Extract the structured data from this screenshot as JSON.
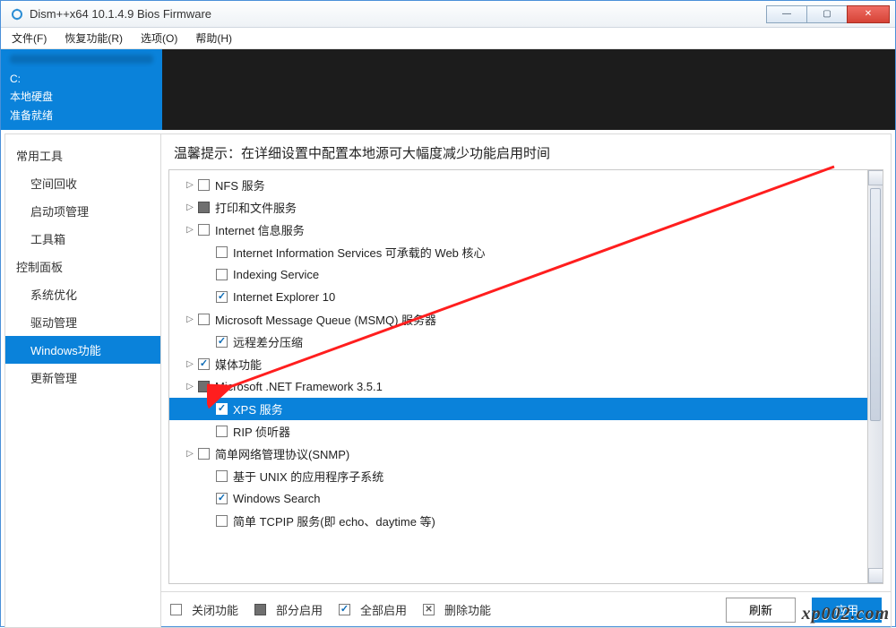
{
  "window": {
    "title": "Dism++x64 10.1.4.9 Bios Firmware"
  },
  "menu": {
    "file": "文件(F)",
    "recover": "恢复功能(R)",
    "options": "选项(O)",
    "help": "帮助(H)"
  },
  "header": {
    "drive": "C:",
    "disk": "本地硬盘",
    "status": "准备就绪"
  },
  "sidebar": {
    "group1_title": "常用工具",
    "group1": [
      "空间回收",
      "启动项管理",
      "工具箱"
    ],
    "group2_title": "控制面板",
    "group2": [
      "系统优化",
      "驱动管理",
      "Windows功能",
      "更新管理"
    ],
    "active_index": 2
  },
  "main": {
    "hint": "温馨提示：在详细设置中配置本地源可大幅度减少功能启用时间",
    "tree": [
      {
        "label": "NFS 服务",
        "expander": true,
        "checked": "none"
      },
      {
        "label": "打印和文件服务",
        "expander": true,
        "checked": "partial"
      },
      {
        "label": "Internet 信息服务",
        "expander": true,
        "checked": "none"
      },
      {
        "label": "Internet Information Services 可承载的 Web 核心",
        "expander": false,
        "checked": "none",
        "indent": true
      },
      {
        "label": "Indexing Service",
        "expander": false,
        "checked": "none",
        "indent": true
      },
      {
        "label": "Internet Explorer 10",
        "expander": false,
        "checked": "checked",
        "indent": true
      },
      {
        "label": "Microsoft Message Queue (MSMQ) 服务器",
        "expander": true,
        "checked": "none"
      },
      {
        "label": "远程差分压缩",
        "expander": false,
        "checked": "checked",
        "indent": true
      },
      {
        "label": "媒体功能",
        "expander": true,
        "checked": "checked"
      },
      {
        "label": "Microsoft .NET Framework 3.5.1",
        "expander": true,
        "checked": "partial"
      },
      {
        "label": "XPS 服务",
        "expander": false,
        "checked": "checked",
        "indent": true,
        "selected": true
      },
      {
        "label": "RIP 侦听器",
        "expander": false,
        "checked": "none",
        "indent": true
      },
      {
        "label": "简单网络管理协议(SNMP)",
        "expander": true,
        "checked": "none"
      },
      {
        "label": "基于 UNIX 的应用程序子系统",
        "expander": false,
        "checked": "none",
        "indent": true
      },
      {
        "label": "Windows Search",
        "expander": false,
        "checked": "checked",
        "indent": true
      },
      {
        "label": "简单 TCPIP 服务(即 echo、daytime 等)",
        "expander": false,
        "checked": "none",
        "indent": true
      }
    ]
  },
  "legend": {
    "off": "关闭功能",
    "partial": "部分启用",
    "all": "全部启用",
    "delete": "删除功能"
  },
  "buttons": {
    "refresh": "刷新",
    "apply": "应用"
  },
  "watermark": "xp002.com"
}
